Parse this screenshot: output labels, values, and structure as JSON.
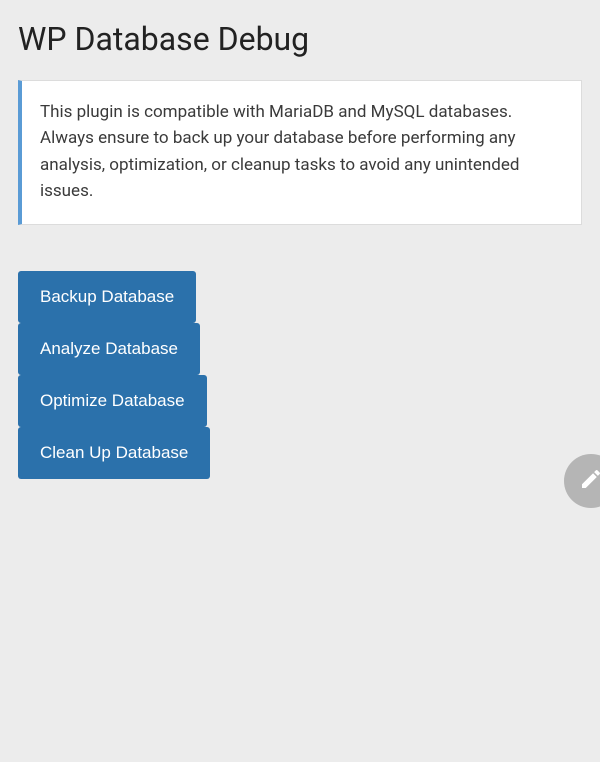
{
  "page": {
    "title": "WP Database Debug"
  },
  "notice": {
    "text": "This plugin is compatible with MariaDB and MySQL databases. Always ensure to back up your database before performing any analysis, optimization, or cleanup tasks to avoid any unintended issues."
  },
  "actions": {
    "backup": "Backup Database",
    "analyze": "Analyze Database",
    "optimize": "Optimize Database",
    "cleanup": "Clean Up Database"
  },
  "fab": {
    "icon": "pencil-icon"
  }
}
